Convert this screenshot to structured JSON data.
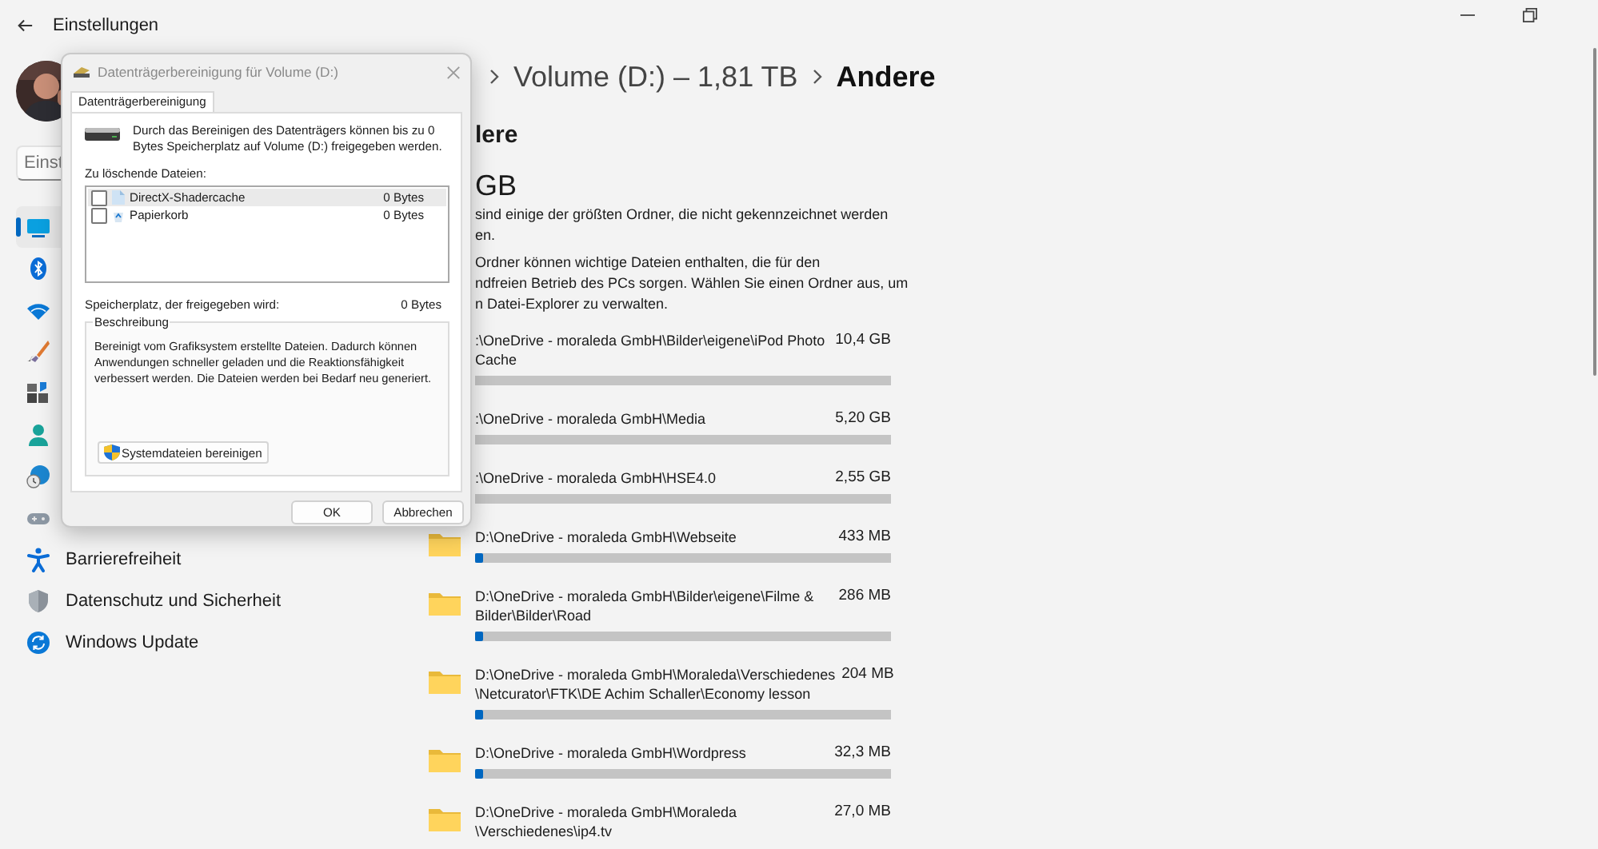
{
  "window": {
    "title": "Einstellungen"
  },
  "search": {
    "placeholder": "Einst"
  },
  "nav": [
    {
      "selected": true
    },
    {
      "selected": false
    },
    {
      "selected": false
    },
    {
      "selected": false
    },
    {
      "selected": false
    },
    {
      "selected": false
    },
    {
      "selected": false
    },
    {
      "selected": false
    },
    {
      "label": "Barrierefreiheit",
      "selected": false
    },
    {
      "label": "Datenschutz und Sicherheit",
      "selected": false
    },
    {
      "label": "Windows Update",
      "selected": false
    }
  ],
  "breadcrumb": [
    {
      "label": "Volume (D:) – 1,81 TB",
      "current": false
    },
    {
      "label": "Andere",
      "current": true
    }
  ],
  "page": {
    "heading": "lere",
    "total": "GB",
    "intro_lines": [
      "sind einige der größten Ordner, die nicht gekennzeichnet werden",
      "en."
    ],
    "note_lines": [
      "Ordner können wichtige Dateien enthalten, die für den",
      "ndfreien Betrieb des PCs sorgen. Wählen Sie einen Ordner aus, um",
      "n Datei-Explorer zu verwalten."
    ]
  },
  "folders": [
    {
      "kind": "covered",
      "path": ":\\OneDrive - moraleda GmbH\\Bilder\\eigene\\iPod Photo\nCache",
      "size": "10,4 GB"
    },
    {
      "kind": "covered",
      "path": ":\\OneDrive - moraleda GmbH\\Media",
      "size": "5,20 GB"
    },
    {
      "kind": "covered",
      "path": ":\\OneDrive - moraleda GmbH\\HSE4.0",
      "size": "2,55 GB"
    },
    {
      "kind": "folder",
      "path": "D:\\OneDrive - moraleda GmbH\\Webseite",
      "size": "433 MB",
      "level": 0.02
    },
    {
      "kind": "folder",
      "path": "D:\\OneDrive - moraleda GmbH\\Bilder\\eigene\\Filme &\nBilder\\Bilder\\Road",
      "size": "286 MB",
      "level": 0.02
    },
    {
      "kind": "folder",
      "path": "D:\\OneDrive - moraleda GmbH\\Moraleda\\Verschiedenes\n\\Netcurator\\FTK\\DE Achim Schaller\\Economy lesson",
      "size": "204 MB",
      "level": 0.02
    },
    {
      "kind": "folder",
      "path": "D:\\OneDrive - moraleda GmbH\\Wordpress",
      "size": "32,3 MB",
      "level": 0.02
    },
    {
      "kind": "folder",
      "path": "D:\\OneDrive - moraleda GmbH\\Moraleda\n\\Verschiedenes\\ip4.tv",
      "size": "27,0 MB"
    }
  ],
  "dialog": {
    "title": "Datenträgerbereinigung für Volume (D:)",
    "tabs": [
      {
        "label": "Datenträgerbereinigung",
        "selected": true
      }
    ],
    "summary": "Durch das Bereinigen des Datenträgers können bis zu 0 Bytes Speicherplatz auf Volume (D:) freigegeben werden.",
    "files_label": "Zu löschende Dateien:",
    "files": [
      {
        "name": "DirectX-Shadercache",
        "size": "0 Bytes",
        "checked": false,
        "selected": true
      },
      {
        "name": "Papierkorb",
        "size": "0 Bytes",
        "checked": false,
        "selected": false
      }
    ],
    "space_label": "Speicherplatz, der freigegeben wird:",
    "space_value": "0 Bytes",
    "description_title": "Beschreibung",
    "description": "Bereinigt vom Grafiksystem erstellte Dateien. Dadurch können Anwendungen schneller geladen und die Reaktionsfähigkeit verbessert werden. Die Dateien werden bei Bedarf neu generiert.",
    "system_button": "Systemdateien bereinigen",
    "buttons": [
      "OK",
      "Abbrechen"
    ]
  }
}
